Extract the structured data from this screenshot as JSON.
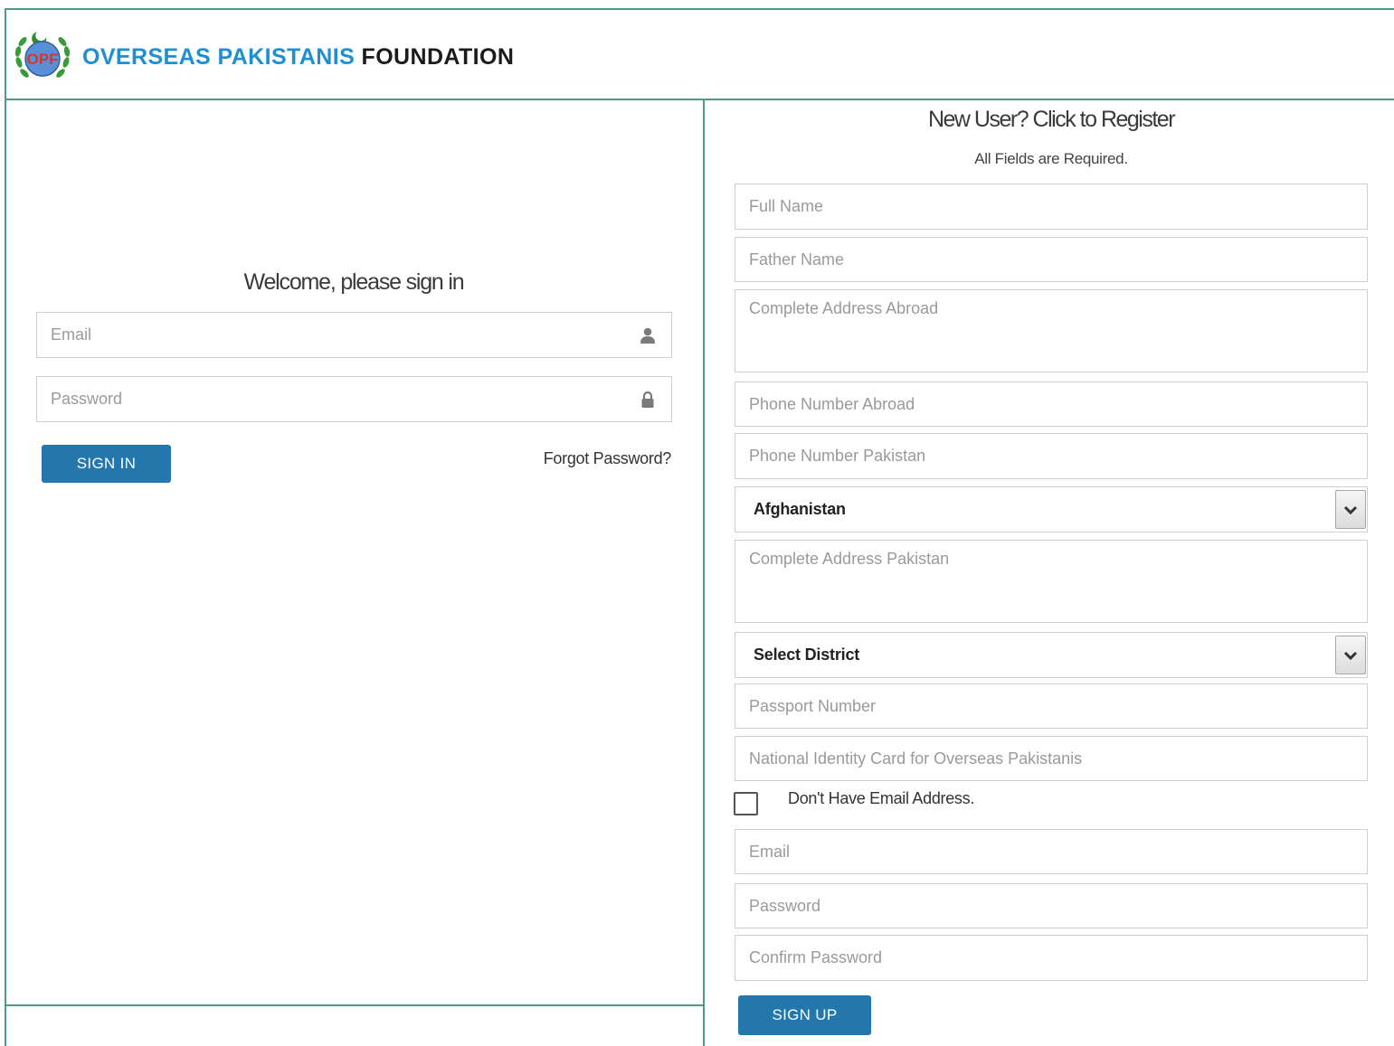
{
  "header": {
    "brand_part1": "OVERSEAS PAKISTANIS",
    "brand_part2": "FOUNDATION",
    "brand_color_primary": "#1f8fd0",
    "logo_icon": "opf-emblem-icon"
  },
  "login": {
    "title": "Welcome, please sign in",
    "email_placeholder": "Email",
    "email_icon": "user-icon",
    "password_placeholder": "Password",
    "password_icon": "lock-icon",
    "sign_in_label": "SIGN IN",
    "forgot_label": "Forgot Password?"
  },
  "register": {
    "title": "New User? Click to Register",
    "subtitle": "All Fields are Required.",
    "full_name_placeholder": "Full Name",
    "father_name_placeholder": "Father Name",
    "address_abroad_placeholder": "Complete Address Abroad",
    "phone_abroad_placeholder": "Phone Number Abroad",
    "phone_pakistan_placeholder": "Phone Number Pakistan",
    "country_selected": "Afghanistan",
    "address_pakistan_placeholder": "Complete Address Pakistan",
    "district_selected": "Select District",
    "passport_placeholder": "Passport Number",
    "nicop_placeholder": "National Identity Card for Overseas Pakistanis",
    "no_email_label": "Don't Have Email Address.",
    "email_placeholder": "Email",
    "password_placeholder": "Password",
    "confirm_password_placeholder": "Confirm Password",
    "sign_up_label": "SIGN UP"
  },
  "colors": {
    "button": "#2477ad",
    "frame": "#4f9a83"
  }
}
